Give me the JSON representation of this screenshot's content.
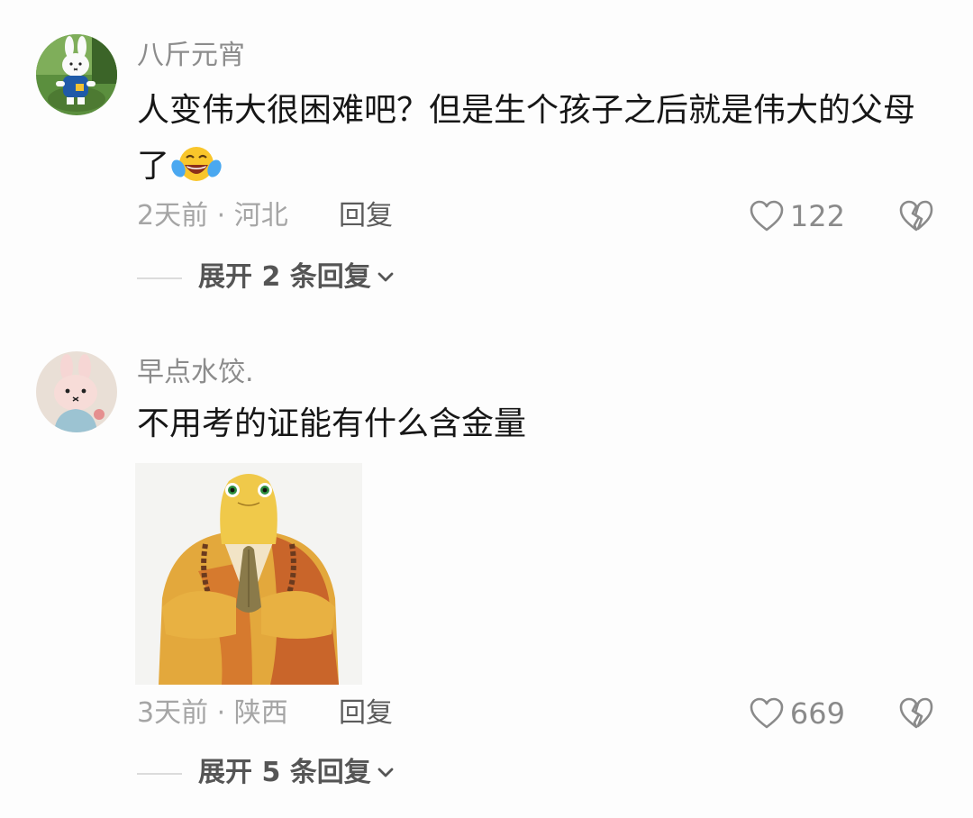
{
  "comments": [
    {
      "username": "八斤元宵",
      "text": "人变伟大很困难吧？但是生个孩子之后就是伟大的父母了",
      "emoji": "laughing-tears-emoji",
      "meta": "2天前 · 河北",
      "reply_label": "回复",
      "likes": "122",
      "expand_label": "展开 2 条回复"
    },
    {
      "username": "早点水饺.",
      "text": "不用考的证能有什么含金量",
      "sticker": "praying-monk-sticker",
      "meta": "3天前 · 陕西",
      "reply_label": "回复",
      "likes": "669",
      "expand_label": "展开 5 条回复"
    }
  ],
  "colors": {
    "username": "#8c8c8c",
    "text": "#161616",
    "meta": "#a5a5a5",
    "icon": "#8a8a8a"
  }
}
